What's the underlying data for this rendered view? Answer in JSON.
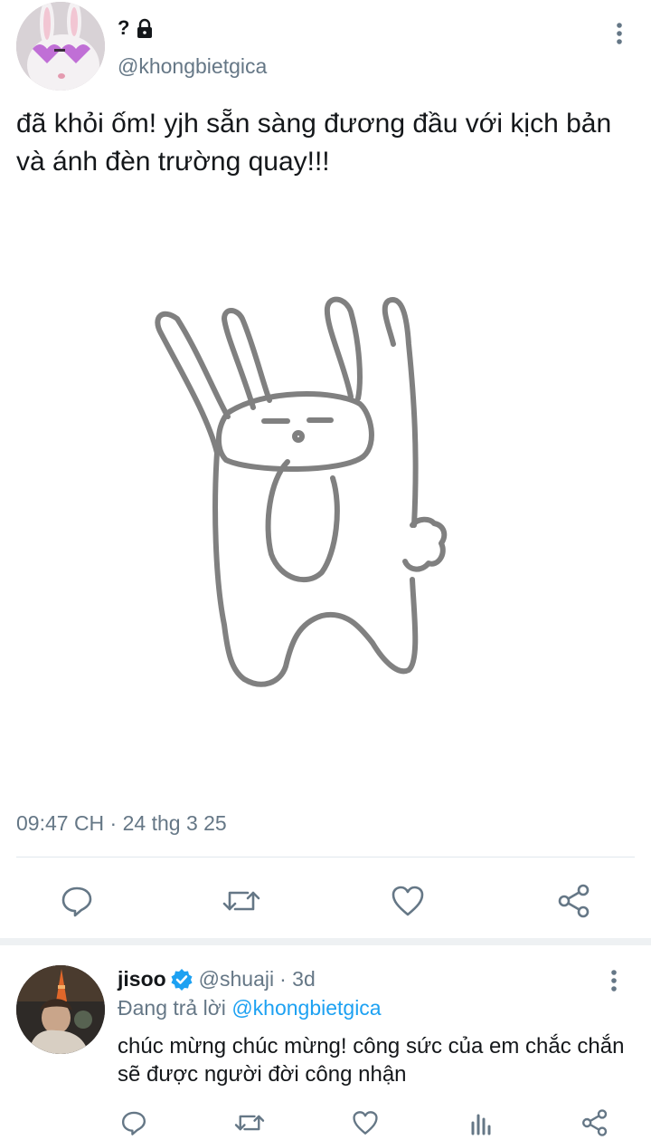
{
  "tweet": {
    "display_name": "?",
    "handle": "@khongbietgica",
    "text": "đã khỏi ốm! yjh sẵn sàng đương đầu với kịch bản và ánh đèn trường quay!!!",
    "timestamp": "09:47 CH · 24 thg 3 25"
  },
  "reply": {
    "name": "jisoo",
    "handle": "@shuaji",
    "age": "· 3d",
    "replying_prefix": "Đang trả lời",
    "replying_to": "@khongbietgica",
    "text": "chúc mừng chúc mừng! công sức của em chắc chắn sẽ được người đời công nhận"
  },
  "icons": {
    "lock": "lock-icon",
    "more": "more-vertical-icon",
    "reply": "comment-icon",
    "retweet": "retweet-icon",
    "like": "heart-icon",
    "share": "share-icon",
    "analytics": "bar-chart-icon",
    "verified": "verified-badge-icon"
  },
  "colors": {
    "accent": "#1da1f2",
    "secondary_text": "#657786",
    "icon": "#657786",
    "divider": "#e1e8ed"
  }
}
